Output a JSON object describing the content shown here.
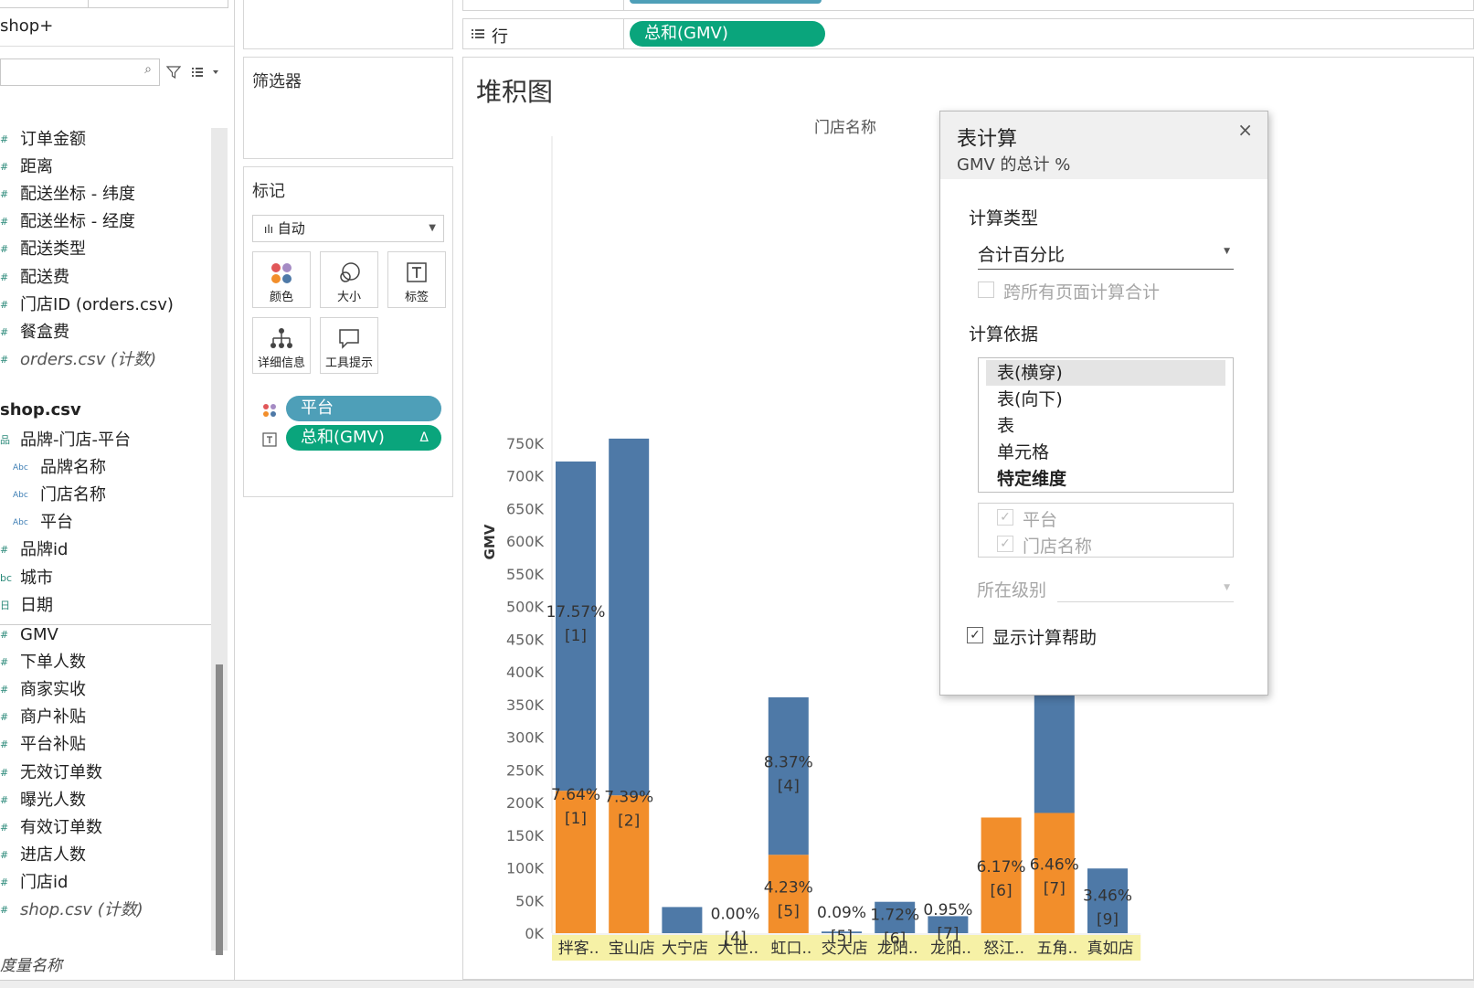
{
  "left_pane": {
    "datasource": "shop+",
    "orders_fields": [
      {
        "label": "订单金额",
        "icon": "#"
      },
      {
        "label": "距离",
        "icon": "#"
      },
      {
        "label": "配送坐标 - 纬度",
        "icon": "#"
      },
      {
        "label": "配送坐标 - 经度",
        "icon": "#"
      },
      {
        "label": "配送类型",
        "icon": "#"
      },
      {
        "label": "配送费",
        "icon": "#"
      },
      {
        "label": "门店ID (orders.csv)",
        "icon": "#"
      },
      {
        "label": "餐盒费",
        "icon": "#"
      },
      {
        "label": "orders.csv (计数)",
        "icon": "#"
      }
    ],
    "shop_section": "shop.csv",
    "shop_fields": [
      {
        "label": "品牌-门店-平台",
        "icon": "品"
      },
      {
        "label": "品牌名称",
        "icon": "Abc"
      },
      {
        "label": "门店名称",
        "icon": "Abc"
      },
      {
        "label": "平台",
        "icon": "Abc"
      },
      {
        "label": "品牌id",
        "icon": "#"
      },
      {
        "label": "城市",
        "icon": "bc"
      },
      {
        "label": "日期",
        "icon": "日"
      }
    ],
    "measures": [
      {
        "label": "GMV",
        "icon": "#"
      },
      {
        "label": "下单人数",
        "icon": "#"
      },
      {
        "label": "商家实收",
        "icon": "#"
      },
      {
        "label": "商户补贴",
        "icon": "#"
      },
      {
        "label": "平台补贴",
        "icon": "#"
      },
      {
        "label": "无效订单数",
        "icon": "#"
      },
      {
        "label": "曝光人数",
        "icon": "#"
      },
      {
        "label": "有效订单数",
        "icon": "#"
      },
      {
        "label": "进店人数",
        "icon": "#"
      },
      {
        "label": "门店id",
        "icon": "#"
      },
      {
        "label": "shop.csv (计数)",
        "icon": "#"
      }
    ],
    "measure_names": "度量名称"
  },
  "shelves": {
    "rows_label": "行",
    "rows_pill": "总和(GMV)",
    "filters_title": "筛选器",
    "marks_title": "标记",
    "mark_type": "自动",
    "mark_buttons": [
      {
        "label": "颜色",
        "icon": "color-icon"
      },
      {
        "label": "大小",
        "icon": "size-icon"
      },
      {
        "label": "标签",
        "icon": "label-icon"
      },
      {
        "label": "详细信息",
        "icon": "detail-icon"
      },
      {
        "label": "工具提示",
        "icon": "tooltip-icon"
      }
    ],
    "mark_pills": [
      {
        "label": "平台",
        "color": "#4e9fb8"
      },
      {
        "label": "总和(GMV)",
        "color": "#0aa57c",
        "delta": "Δ"
      }
    ]
  },
  "view": {
    "title": "堆积图",
    "column_header": "门店名称"
  },
  "colors": {
    "blue": "#4e79a7",
    "orange": "#f28e2b",
    "green_pill": "#0aa57c",
    "teal_pill": "#4e9fb8",
    "axis_highlight": "#f6f1a6"
  },
  "chart_data": {
    "type": "bar",
    "stacked": true,
    "xlabel": "",
    "ylabel": "GMV",
    "ylim": [
      0,
      780000
    ],
    "yticks": [
      "0K",
      "50K",
      "100K",
      "150K",
      "200K",
      "250K",
      "300K",
      "350K",
      "400K",
      "450K",
      "500K",
      "550K",
      "600K",
      "650K",
      "700K",
      "750K"
    ],
    "categories": [
      "拌客..",
      "宝山店",
      "大宁店",
      "大世..",
      "虹口..",
      "交大店",
      "龙阳..",
      "龙阳..",
      "怒江..",
      "五角..",
      "真如店"
    ],
    "series": [
      {
        "color": "#f28e2b",
        "values": [
          218000,
          211000,
          0,
          0,
          120000,
          0,
          0,
          0,
          177000,
          184000,
          0
        ]
      },
      {
        "color": "#4e79a7",
        "values": [
          504000,
          546000,
          40000,
          0,
          241000,
          2500,
          48000,
          26000,
          0,
          400000,
          99000
        ]
      }
    ],
    "labels": [
      {
        "cat": 0,
        "value": 190000,
        "text": "7.64%",
        "sub": "[1]"
      },
      {
        "cat": 0,
        "value": 470000,
        "text": "17.57%",
        "sub": "[1]"
      },
      {
        "cat": 1,
        "value": 187000,
        "text": "7.39%",
        "sub": "[2]"
      },
      {
        "cat": 3,
        "value": 8000,
        "text": "0.00%",
        "sub": "[4]"
      },
      {
        "cat": 4,
        "value": 240000,
        "text": "8.37%",
        "sub": "[4]"
      },
      {
        "cat": 4,
        "value": 48000,
        "text": "4.23%",
        "sub": "[5]"
      },
      {
        "cat": 5,
        "value": 10000,
        "text": "0.09%",
        "sub": "[5]"
      },
      {
        "cat": 6,
        "value": 6000,
        "text": "1.72%",
        "sub": "[6]"
      },
      {
        "cat": 7,
        "value": 14000,
        "text": "0.95%",
        "sub": "[7]"
      },
      {
        "cat": 8,
        "value": 80000,
        "text": "6.17%",
        "sub": "[6]"
      },
      {
        "cat": 9,
        "value": 83000,
        "text": "6.46%",
        "sub": "[7]"
      },
      {
        "cat": 10,
        "value": 36000,
        "text": "3.46%",
        "sub": "[9]"
      }
    ]
  },
  "dialog": {
    "title": "表计算",
    "subtitle": "GMV 的总计 %",
    "calc_type_label": "计算类型",
    "calc_type_value": "合计百分比",
    "across_pages": "跨所有页面计算合计",
    "compute_using_label": "计算依据",
    "compute_options": [
      "表(横穿)",
      "表(向下)",
      "表",
      "单元格",
      "特定维度"
    ],
    "dimensions": [
      "平台",
      "门店名称"
    ],
    "at_level_label": "所在级别",
    "show_help": "显示计算帮助"
  }
}
